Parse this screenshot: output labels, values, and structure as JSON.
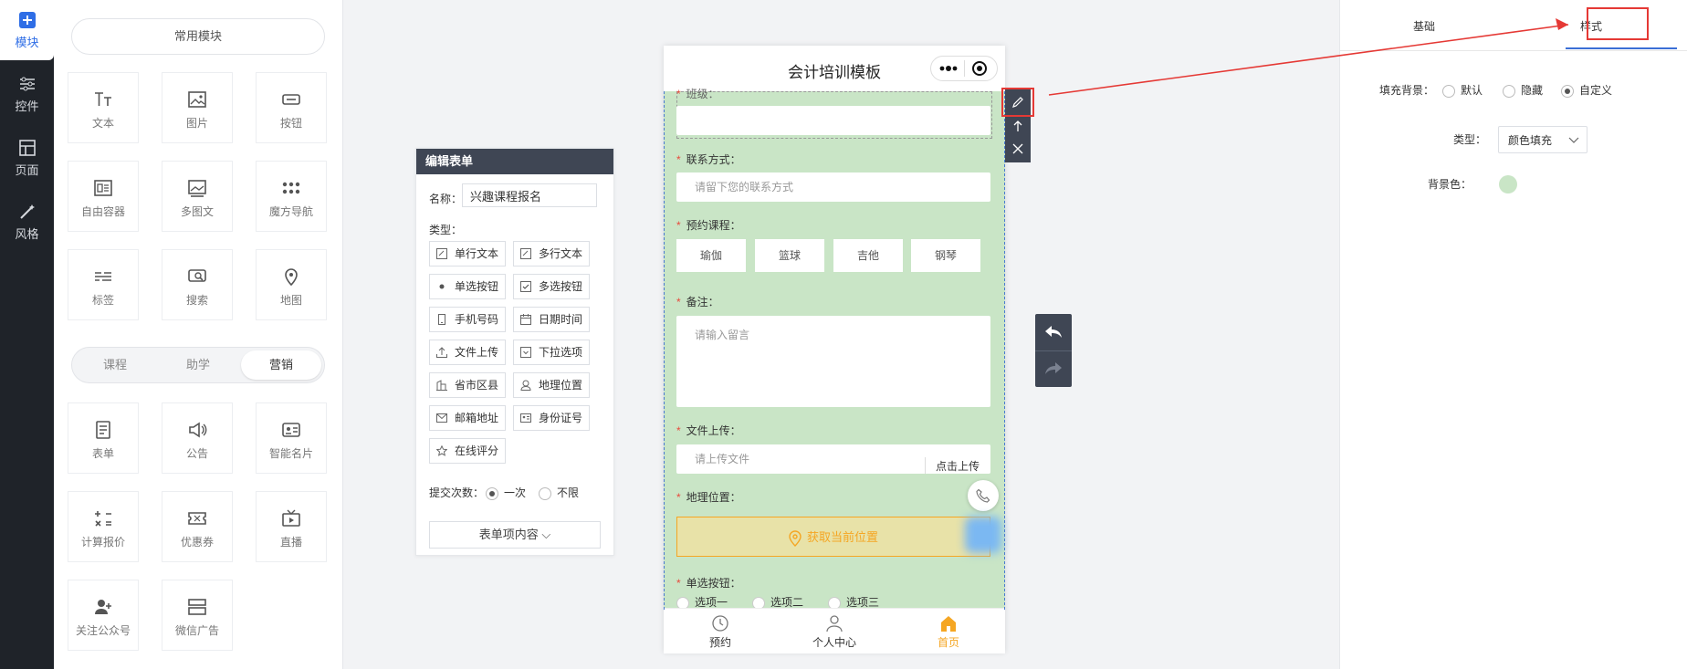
{
  "nav": {
    "items": [
      {
        "label": "模块",
        "icon": "plus-square-icon"
      },
      {
        "label": "控件",
        "icon": "sliders-icon"
      },
      {
        "label": "页面",
        "icon": "layout-icon"
      },
      {
        "label": "风格",
        "icon": "magic-wand-icon"
      }
    ]
  },
  "modules": {
    "common_title": "常用模块",
    "common": [
      {
        "label": "文本",
        "icon": "text-icon"
      },
      {
        "label": "图片",
        "icon": "image-icon"
      },
      {
        "label": "按钮",
        "icon": "button-icon"
      },
      {
        "label": "自由容器",
        "icon": "container-icon"
      },
      {
        "label": "多图文",
        "icon": "multi-image-icon"
      },
      {
        "label": "魔方导航",
        "icon": "grid-dots-icon"
      },
      {
        "label": "标签",
        "icon": "tag-icon"
      },
      {
        "label": "搜索",
        "icon": "search-icon"
      },
      {
        "label": "地图",
        "icon": "map-pin-icon"
      }
    ],
    "tabs": [
      {
        "label": "课程"
      },
      {
        "label": "助学"
      },
      {
        "label": "营销"
      }
    ],
    "marketing": [
      {
        "label": "表单",
        "icon": "form-icon"
      },
      {
        "label": "公告",
        "icon": "speaker-icon"
      },
      {
        "label": "智能名片",
        "icon": "card-icon"
      },
      {
        "label": "计算报价",
        "icon": "calculator-icon"
      },
      {
        "label": "优惠券",
        "icon": "coupon-icon"
      },
      {
        "label": "直播",
        "icon": "live-tv-icon"
      },
      {
        "label": "关注公众号",
        "icon": "user-add-icon"
      },
      {
        "label": "微信广告",
        "icon": "ad-icon"
      }
    ]
  },
  "editform": {
    "title": "编辑表单",
    "name_label": "名称：",
    "name_value": "兴趣课程报名",
    "type_label": "类型：",
    "types": [
      {
        "label": "单行文本",
        "icon": "edit-icon"
      },
      {
        "label": "多行文本",
        "icon": "edit-icon"
      },
      {
        "label": "单选按钮",
        "icon": "radio-icon"
      },
      {
        "label": "多选按钮",
        "icon": "checkbox-icon"
      },
      {
        "label": "手机号码",
        "icon": "phone-icon"
      },
      {
        "label": "日期时间",
        "icon": "calendar-icon"
      },
      {
        "label": "文件上传",
        "icon": "upload-icon"
      },
      {
        "label": "下拉选项",
        "icon": "dropdown-icon"
      },
      {
        "label": "省市区县",
        "icon": "building-icon"
      },
      {
        "label": "地理位置",
        "icon": "location-icon"
      },
      {
        "label": "邮箱地址",
        "icon": "mail-icon"
      },
      {
        "label": "身份证号",
        "icon": "id-card-icon"
      },
      {
        "label": "在线评分",
        "icon": "star-icon"
      }
    ],
    "submit_label": "提交次数：",
    "submit_once": "一次",
    "submit_unlimited": "不限",
    "items_button": "表单项内容 ⌵"
  },
  "phone": {
    "title": "会计培训模板",
    "fields": {
      "class_label": "班级：",
      "contact_label": "联系方式：",
      "contact_placeholder": "请留下您的联系方式",
      "course_label": "预约课程：",
      "courses": [
        "瑜伽",
        "篮球",
        "吉他",
        "钢琴"
      ],
      "remark_label": "备注：",
      "remark_placeholder": "请输入留言",
      "upload_label": "文件上传：",
      "upload_placeholder": "请上传文件",
      "upload_button": "点击上传",
      "location_label": "地理位置：",
      "location_button": "获取当前位置",
      "radio_label": "单选按钮：",
      "radio_options": [
        "选项一",
        "选项二",
        "选项三"
      ]
    },
    "tabbar": [
      {
        "label": "预约",
        "icon": "clock-icon"
      },
      {
        "label": "个人中心",
        "icon": "user-icon"
      },
      {
        "label": "首页",
        "icon": "home-icon"
      }
    ],
    "accent": "#f5a623"
  },
  "right": {
    "tabs": [
      {
        "label": "基础"
      },
      {
        "label": "样式"
      }
    ],
    "fill_label": "填充背景：",
    "fill_options": [
      "默认",
      "隐藏",
      "自定义"
    ],
    "type_label": "类型：",
    "type_value": "颜色填充",
    "bg_label": "背景色：",
    "bg_color": "#c9e5c6"
  },
  "colors": {
    "annotation": "#e53935",
    "primary": "#2f6ee6"
  }
}
